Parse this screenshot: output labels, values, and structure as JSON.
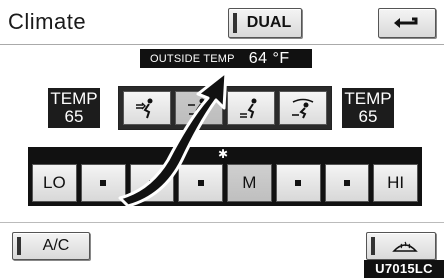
{
  "screen": {
    "title": "Climate"
  },
  "header": {
    "dual_label": "DUAL",
    "back_icon": "return-arrow-icon"
  },
  "outside_temp": {
    "label": "OUTSIDE TEMP",
    "value": "64 °F"
  },
  "temp_left": {
    "label": "TEMP",
    "value": "65"
  },
  "temp_right": {
    "label": "TEMP",
    "value": "65"
  },
  "modes": [
    {
      "icon": "face-airflow-icon",
      "active": false
    },
    {
      "icon": "face-feet-airflow-icon",
      "active": true
    },
    {
      "icon": "feet-airflow-icon",
      "active": false
    },
    {
      "icon": "feet-defrost-airflow-icon",
      "active": false
    }
  ],
  "fan": {
    "icon": "fan-icon",
    "speeds": [
      {
        "label": "LO"
      },
      {
        "label": ""
      },
      {
        "label": ""
      },
      {
        "label": ""
      },
      {
        "label": "M",
        "active": true
      },
      {
        "label": ""
      },
      {
        "label": ""
      },
      {
        "label": "HI"
      }
    ]
  },
  "ac": {
    "label": "A/C"
  },
  "defrost": {
    "icon": "windshield-defrost-icon"
  },
  "figure_code": "U7015LC"
}
